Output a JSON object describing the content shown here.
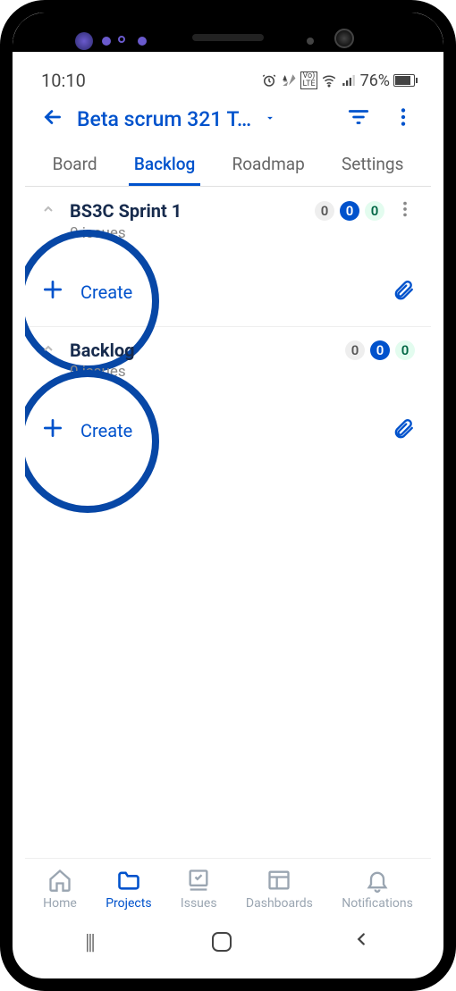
{
  "status": {
    "time": "10:10",
    "battery": "76%"
  },
  "header": {
    "title": "Beta scrum 321 T…"
  },
  "tabs": [
    {
      "label": "Board"
    },
    {
      "label": "Backlog",
      "active": true
    },
    {
      "label": "Roadmap"
    },
    {
      "label": "Settings"
    }
  ],
  "sections": [
    {
      "title": "BS3C Sprint 1",
      "subtitle": "0 issues",
      "badges": {
        "todo": "0",
        "inprogress": "0",
        "done": "0"
      },
      "create": "Create"
    },
    {
      "title": "Backlog",
      "subtitle": "0 issues",
      "badges": {
        "todo": "0",
        "inprogress": "0",
        "done": "0"
      },
      "create": "Create"
    }
  ],
  "bottomNav": [
    {
      "label": "Home"
    },
    {
      "label": "Projects",
      "active": true
    },
    {
      "label": "Issues"
    },
    {
      "label": "Dashboards"
    },
    {
      "label": "Notifications"
    }
  ]
}
